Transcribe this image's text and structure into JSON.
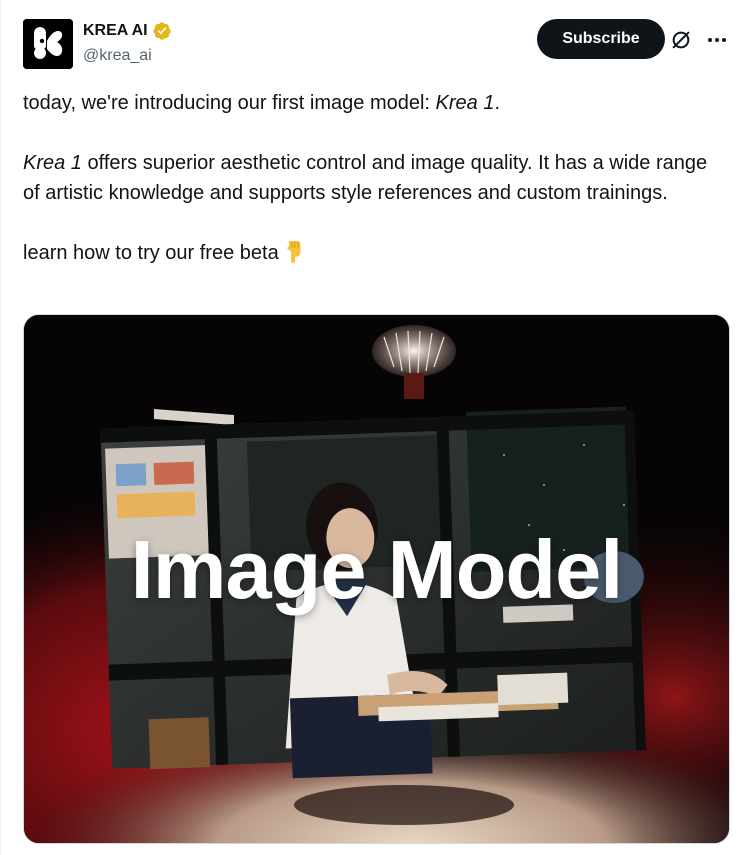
{
  "author": {
    "display_name": "KREA AI",
    "handle": "@krea_ai",
    "verified_badge": "gold-verified-icon",
    "avatar_icon": "krea-logo-icon"
  },
  "actions": {
    "subscribe_label": "Subscribe",
    "grok_icon": "grok-icon",
    "more_icon": "more-icon"
  },
  "tweet": {
    "line1_prefix": "today, we're introducing our first image model: ",
    "line1_emph": "Krea 1",
    "line1_suffix": ".",
    "para2_emph": "Krea 1",
    "para2_text": " offers superior aesthetic control and image quality. It has a wide range of artistic knowledge and supports style references and custom trainings.",
    "para3_text": "learn how to try our free beta",
    "para3_emoji": "backhand-index-pointing-down-icon"
  },
  "media": {
    "overlay_title": "Image Model"
  },
  "colors": {
    "text": "#0f1419",
    "secondary": "#536471",
    "button_bg": "#0f1419",
    "verified_gold": "#e2b719"
  }
}
